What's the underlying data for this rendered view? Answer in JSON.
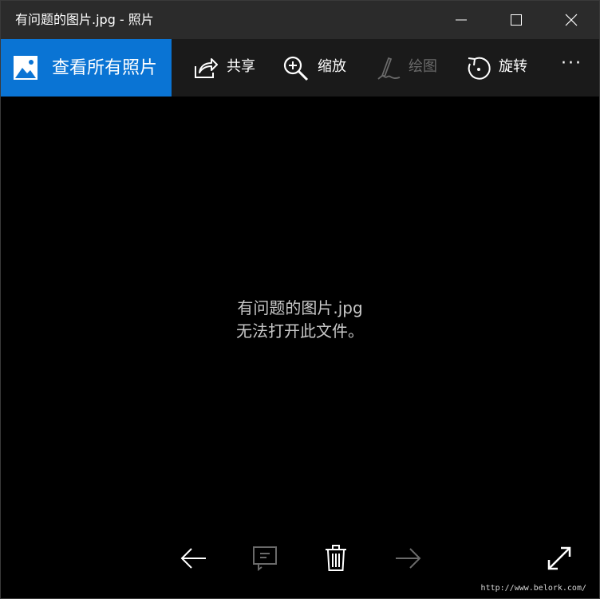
{
  "window": {
    "title": "有问题的图片.jpg - 照片",
    "controls": [
      "minimize",
      "maximize",
      "close"
    ]
  },
  "command_bar": {
    "view_all_label": "查看所有照片",
    "share_label": "共享",
    "zoom_label": "缩放",
    "draw_label": "绘图",
    "rotate_label": "旋转",
    "more_label": "···",
    "icons": {
      "view_all": "photo-gallery-icon",
      "share": "share-icon",
      "zoom": "zoom-in-icon",
      "draw": "draw-pen-icon",
      "rotate": "rotate-icon"
    },
    "accent_color": "#0a74d4"
  },
  "viewer": {
    "file_name": "有问题的图片.jpg",
    "error_message": "无法打开此文件。"
  },
  "bottom_bar": {
    "icons": [
      "previous-arrow-icon",
      "slideshow-icon",
      "delete-icon",
      "next-arrow-icon",
      "fullscreen-icon"
    ],
    "next_enabled": false,
    "slideshow_enabled": false
  },
  "watermark": "http://www.belork.com/"
}
